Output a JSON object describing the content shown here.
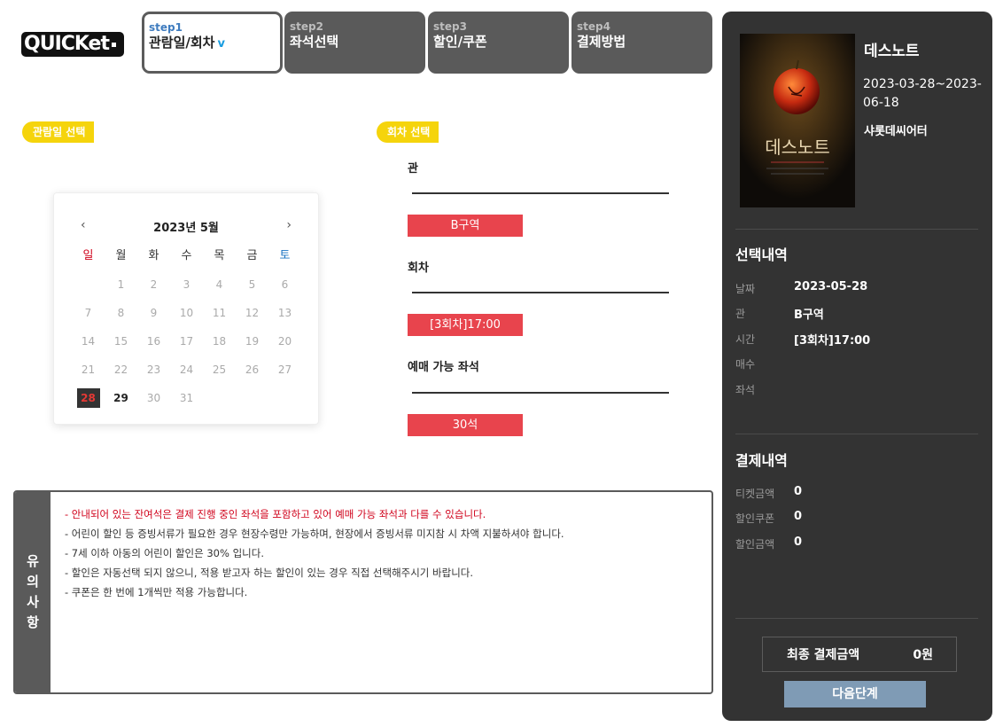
{
  "logo": {
    "text": "QUICKet"
  },
  "steps": [
    {
      "num": "step1",
      "title": "관람일/회차",
      "active": true
    },
    {
      "num": "step2",
      "title": "좌석선택",
      "active": false
    },
    {
      "num": "step3",
      "title": "할인/쿠폰",
      "active": false
    },
    {
      "num": "step4",
      "title": "결제방법",
      "active": false
    }
  ],
  "date_section": {
    "tag": "관람일 선택"
  },
  "calendar": {
    "prev": "‹",
    "next": "›",
    "month_label": "2023년 5월",
    "weekdays": [
      "일",
      "월",
      "화",
      "수",
      "목",
      "금",
      "토"
    ],
    "first_weekday": 1,
    "days_in_month": 31,
    "selected_day": 28,
    "active_days": [
      28,
      29
    ]
  },
  "session_section": {
    "tag": "회차 선택",
    "hall_label": "관",
    "hall_value": "B구역",
    "round_label": "회차",
    "round_value": "[3회차]17:00",
    "seats_label": "예매 가능 좌석",
    "seats_value": "30석"
  },
  "notice": {
    "side_label": "유의사항",
    "items": [
      {
        "text": "- 안내되어 있는 잔여석은 결제 진행 중인 좌석을 포함하고 있어 예매 가능 좌석과 다를 수 있습니다.",
        "emphasis": true
      },
      {
        "text": "- 어린이 할인 등 증빙서류가 필요한 경우 현장수령만 가능하며, 현장에서 증빙서류 미지참 시 차액 지불하셔야 합니다.",
        "emphasis": false
      },
      {
        "text": "- 7세 이하 아동의 어린이 할인은 30% 입니다.",
        "emphasis": false
      },
      {
        "text": "- 할인은 자동선택 되지 않으니, 적용 받고자 하는 할인이 있는 경우 직접 선택해주시기 바랍니다.",
        "emphasis": false
      },
      {
        "text": "- 쿠폰은 한 번에 1개씩만 적용 가능합니다.",
        "emphasis": false
      }
    ]
  },
  "show": {
    "title": "데스노트",
    "period": "2023-03-28~2023-06-18",
    "venue": "샤롯데씨어터",
    "poster_text": "데스노트"
  },
  "selection": {
    "heading": "선택내역",
    "rows": [
      {
        "label": "날짜",
        "value": "2023-05-28"
      },
      {
        "label": "관",
        "value": "B구역"
      },
      {
        "label": "시간",
        "value": "[3회차]17:00"
      },
      {
        "label": "매수",
        "value": ""
      },
      {
        "label": "좌석",
        "value": ""
      }
    ]
  },
  "payment": {
    "heading": "결제내역",
    "rows": [
      {
        "label": "티켓금액",
        "value": "0"
      },
      {
        "label": "할인쿠폰",
        "value": "0"
      },
      {
        "label": "할인금액",
        "value": "0"
      }
    ]
  },
  "final": {
    "label": "최종 결제금액",
    "value": "0원"
  },
  "next_button": "다음단계",
  "colors": {
    "accent_red": "#e8444d",
    "tag_yellow": "#f5d40c",
    "panel_dark": "#333333",
    "next_button": "#7f9bb5"
  }
}
